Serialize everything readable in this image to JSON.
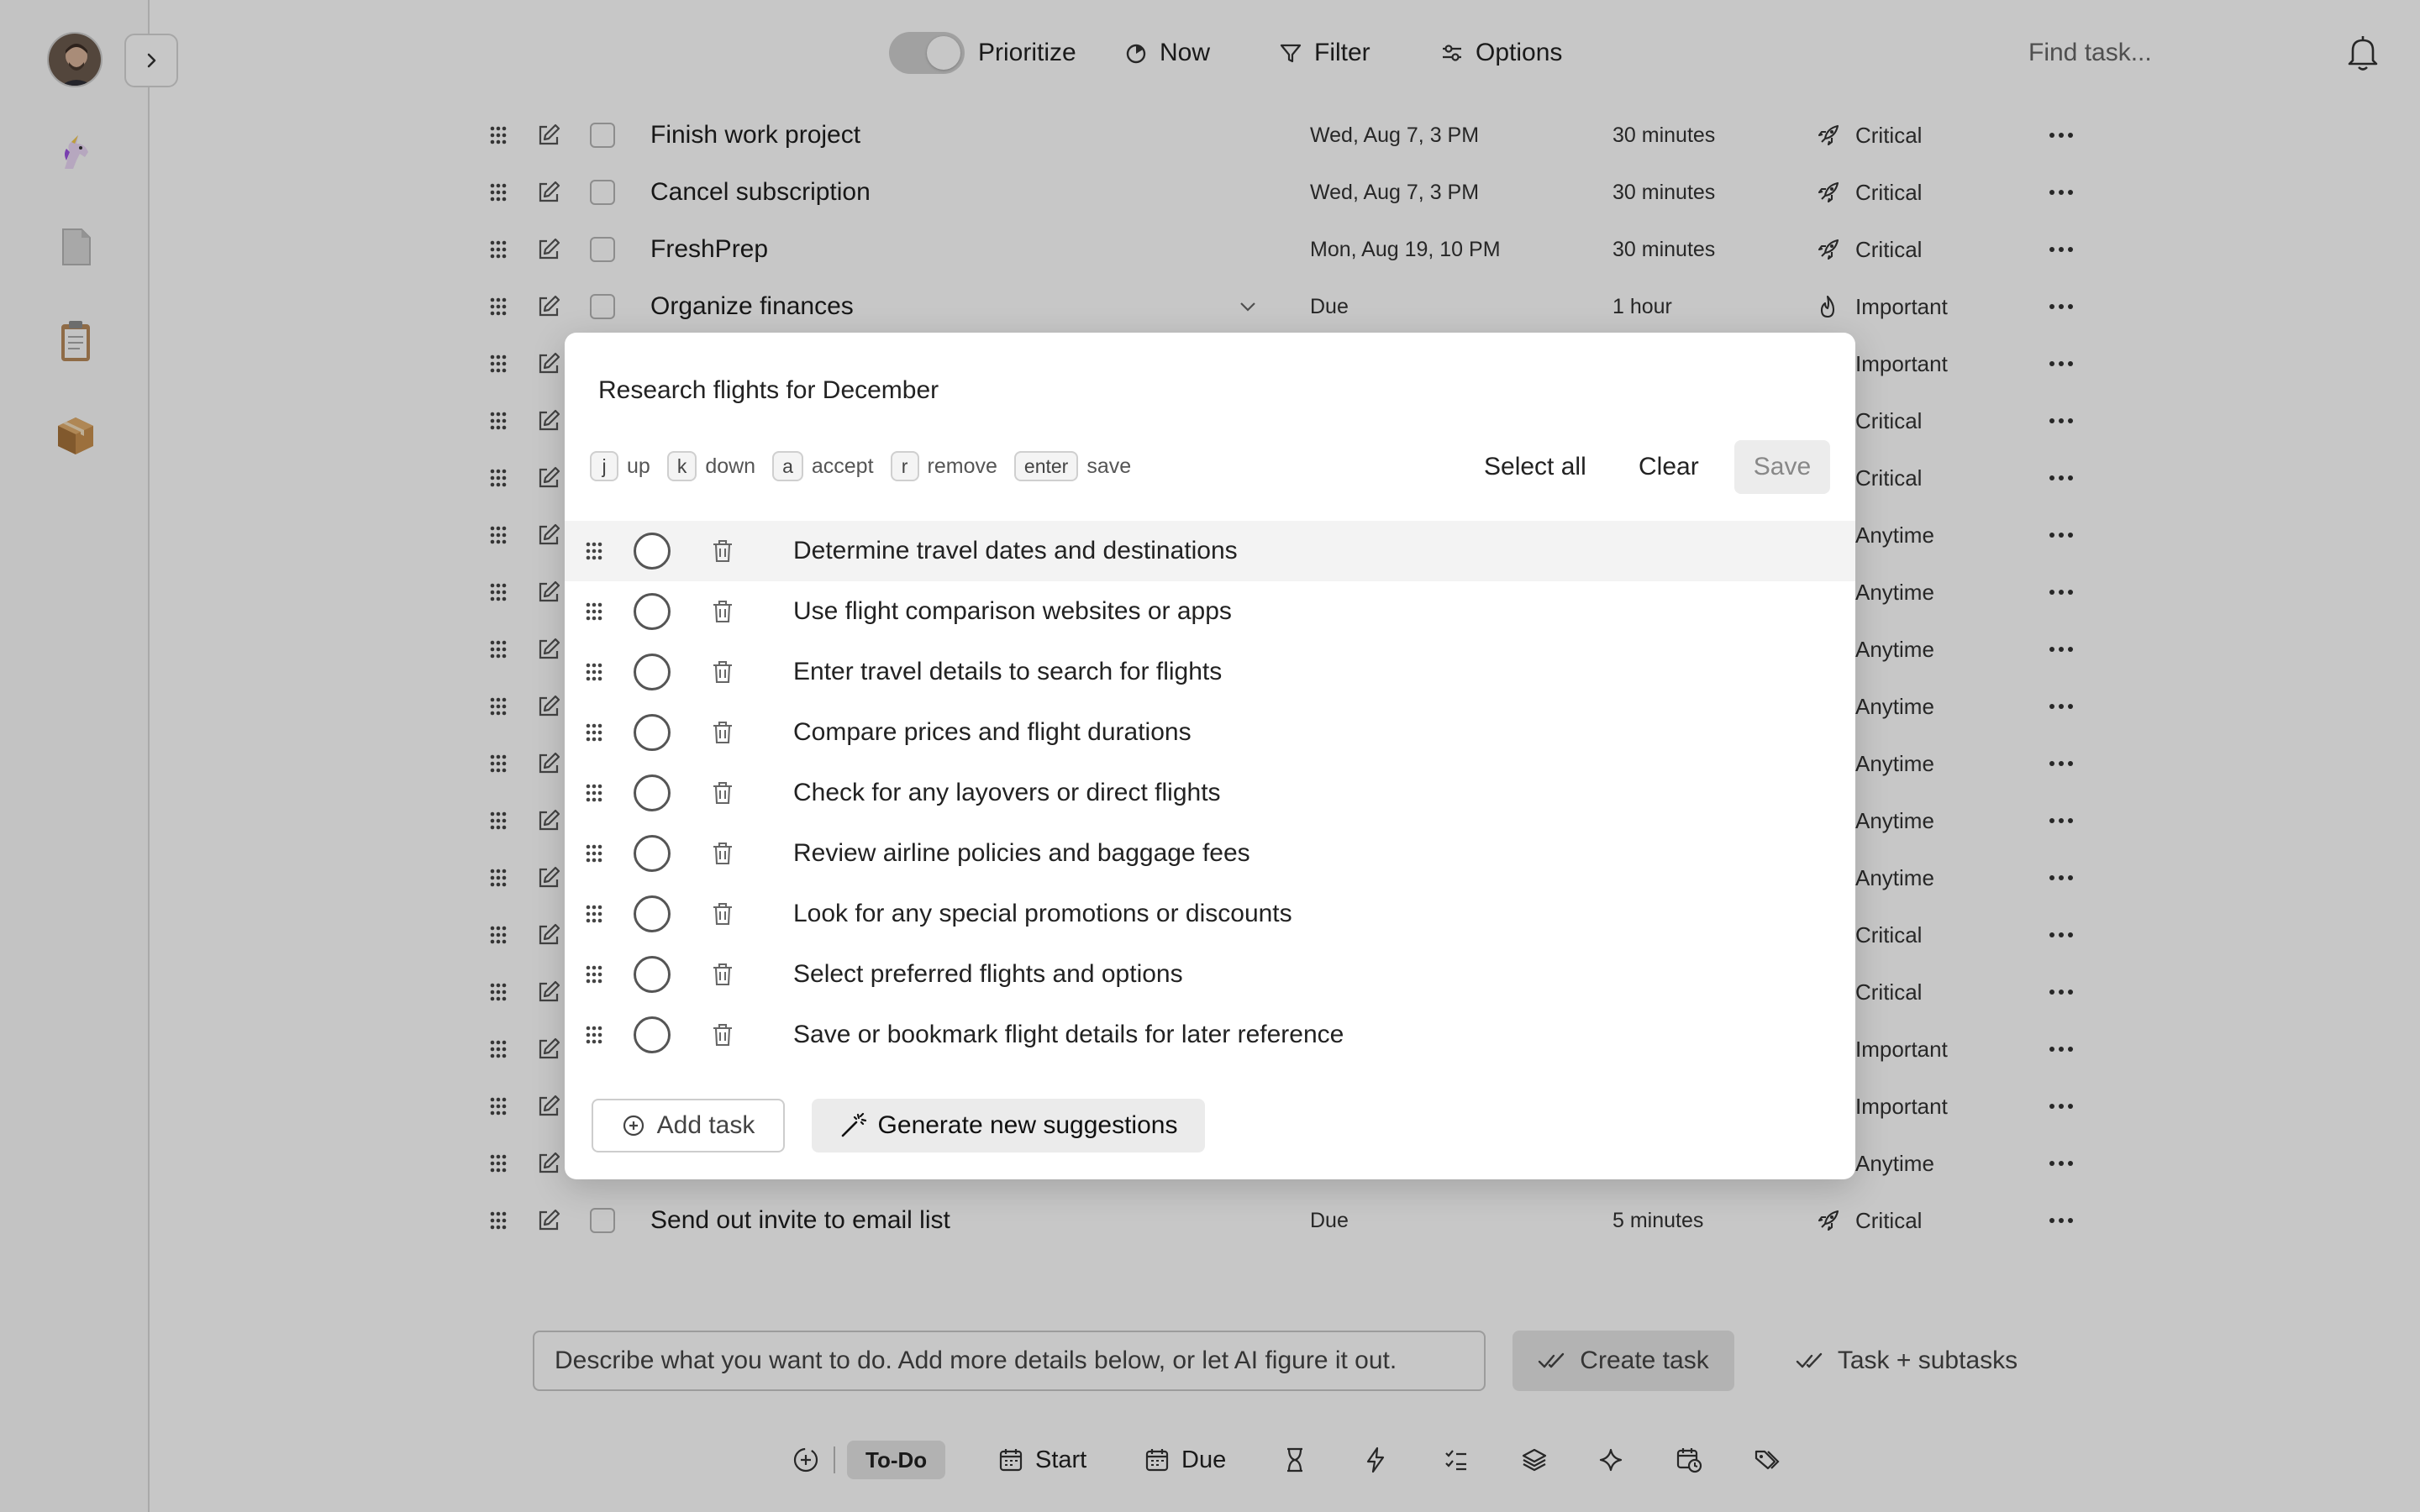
{
  "topbar": {
    "prioritize_label": "Prioritize",
    "now_label": "Now",
    "filter_label": "Filter",
    "options_label": "Options",
    "find_placeholder": "Find task..."
  },
  "sidebar": {
    "icons": [
      "unicorn-icon",
      "document-icon",
      "clipboard-icon",
      "package-icon"
    ]
  },
  "tasks": [
    {
      "title": "Finish work project",
      "date": "Wed, Aug 7, 3 PM",
      "duration": "30 minutes",
      "priority": "Critical",
      "priority_icon": "rocket-icon"
    },
    {
      "title": "Cancel subscription",
      "date": "Wed, Aug 7, 3 PM",
      "duration": "30 minutes",
      "priority": "Critical",
      "priority_icon": "rocket-icon"
    },
    {
      "title": "FreshPrep",
      "date": "Mon, Aug 19, 10 PM",
      "duration": "30 minutes",
      "priority": "Critical",
      "priority_icon": "rocket-icon"
    },
    {
      "title": "Organize finances",
      "date": "Due",
      "duration": "1 hour",
      "priority": "Important",
      "priority_icon": "flame-icon"
    },
    {
      "title": "",
      "date": "",
      "duration": "",
      "priority": "Important",
      "priority_icon": ""
    },
    {
      "title": "",
      "date": "",
      "duration": "",
      "priority": "Critical",
      "priority_icon": ""
    },
    {
      "title": "",
      "date": "",
      "duration": "",
      "priority": "Critical",
      "priority_icon": ""
    },
    {
      "title": "",
      "date": "",
      "duration": "",
      "priority": "Anytime",
      "priority_icon": ""
    },
    {
      "title": "",
      "date": "",
      "duration": "",
      "priority": "Anytime",
      "priority_icon": ""
    },
    {
      "title": "",
      "date": "",
      "duration": "",
      "priority": "Anytime",
      "priority_icon": ""
    },
    {
      "title": "",
      "date": "",
      "duration": "",
      "priority": "Anytime",
      "priority_icon": ""
    },
    {
      "title": "",
      "date": "",
      "duration": "",
      "priority": "Anytime",
      "priority_icon": ""
    },
    {
      "title": "",
      "date": "",
      "duration": "",
      "priority": "Anytime",
      "priority_icon": ""
    },
    {
      "title": "",
      "date": "",
      "duration": "",
      "priority": "Anytime",
      "priority_icon": ""
    },
    {
      "title": "",
      "date": "",
      "duration": "",
      "priority": "Critical",
      "priority_icon": ""
    },
    {
      "title": "",
      "date": "",
      "duration": "",
      "priority": "Critical",
      "priority_icon": ""
    },
    {
      "title": "",
      "date": "",
      "duration": "",
      "priority": "Important",
      "priority_icon": ""
    },
    {
      "title": "",
      "date": "",
      "duration": "",
      "priority": "Important",
      "priority_icon": ""
    },
    {
      "title": "",
      "date": "",
      "duration": "",
      "priority": "Anytime",
      "priority_icon": ""
    },
    {
      "title": "Send out invite to email list",
      "date": "Due",
      "duration": "5 minutes",
      "priority": "Critical",
      "priority_icon": "rocket-icon"
    }
  ],
  "modal": {
    "title": "Research flights for December",
    "shortcuts": [
      {
        "key": "j",
        "label": "up"
      },
      {
        "key": "k",
        "label": "down"
      },
      {
        "key": "a",
        "label": "accept"
      },
      {
        "key": "r",
        "label": "remove"
      },
      {
        "key": "enter",
        "label": "save"
      }
    ],
    "select_all_label": "Select all",
    "clear_label": "Clear",
    "save_label": "Save",
    "suggestions": [
      "Determine travel dates and destinations",
      "Use flight comparison websites or apps",
      "Enter travel details to search for flights",
      "Compare prices and flight durations",
      "Check for any layovers or direct flights",
      "Review airline policies and baggage fees",
      "Look for any special promotions or discounts",
      "Select preferred flights and options",
      "Save or bookmark flight details for later reference"
    ],
    "add_task_label": "Add task",
    "generate_label": "Generate new suggestions"
  },
  "composer": {
    "placeholder": "Describe what you want to do. Add more details below, or let AI figure it out.",
    "create_task_label": "Create task",
    "task_subtasks_label": "Task + subtasks"
  },
  "bottom_toolbar": {
    "todo_label": "To-Do",
    "start_label": "Start",
    "due_label": "Due"
  }
}
